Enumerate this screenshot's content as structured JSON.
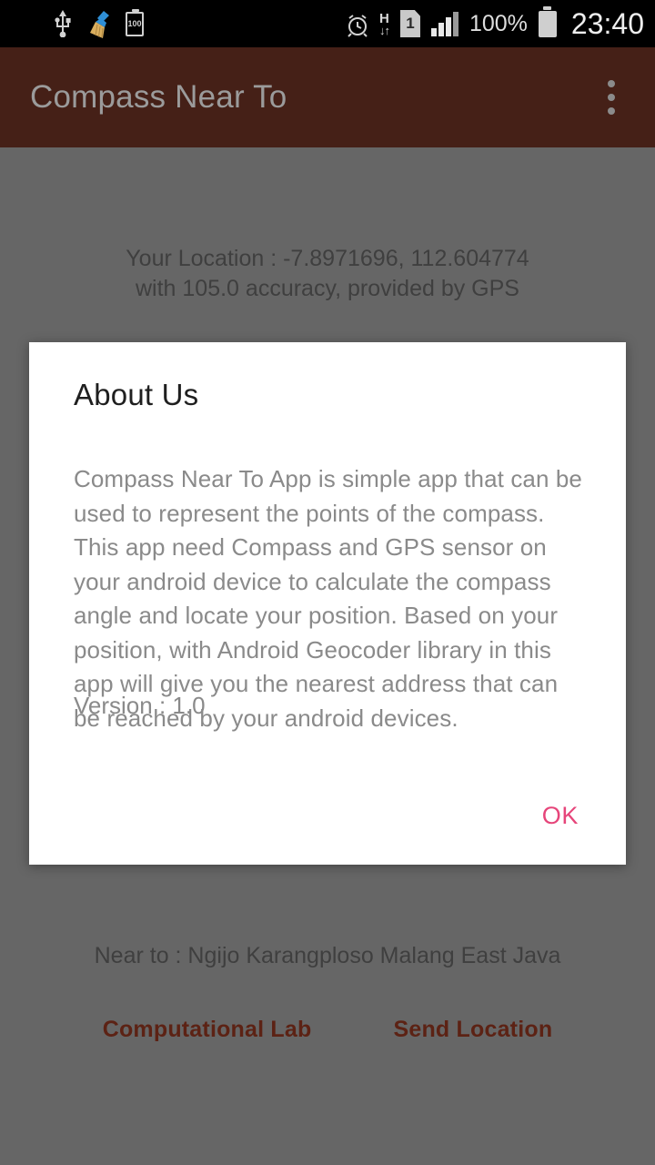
{
  "status_bar": {
    "time": "23:40",
    "battery_percent": "100%",
    "network_type": "H",
    "sim_label": "1",
    "battery_saver_label": "100",
    "icons": {
      "usb": "usb-icon",
      "cleaner": "broom-icon",
      "battery_widget": "battery-saver-icon",
      "alarm": "alarm-clock-icon",
      "data_transfer": "hspa-data-icon",
      "sim": "sim-card-icon",
      "signal": "signal-bars-icon",
      "battery": "battery-icon"
    },
    "colors": {
      "background": "#000000",
      "foreground": "#dedede"
    }
  },
  "app_bar": {
    "title": "Compass Near To",
    "overflow_label": "overflow-menu",
    "colors": {
      "background": "#452017",
      "title": "#9b9b9b"
    }
  },
  "main": {
    "location_line1": "Your Location : -7.8971696, 112.604774",
    "location_line2": "with 105.0 accuracy, provided by GPS",
    "near_to": "Near to : Ngijo Karangploso Malang East Java",
    "buttons": [
      {
        "label": "Computational Lab",
        "name": "computational-lab-button"
      },
      {
        "label": "Send Location",
        "name": "send-location-button"
      }
    ],
    "colors": {
      "scrim": "#666666",
      "text": "#3f3f3f",
      "button_text": "#5c2214"
    }
  },
  "dialog": {
    "title": "About Us",
    "body": "Compass Near To App is simple app that can be used to represent the points of the compass. This app need Compass and GPS sensor on your android device to calculate the compass angle and locate your position. Based on your position, with Android Geocoder library in this app will give you the nearest address that can be reached by your android devices.",
    "version": "Version : 1.0",
    "ok_label": "OK",
    "colors": {
      "surface": "#ffffff",
      "title": "#1f1f1f",
      "body": "#8a8a8a",
      "accent": "#e6457a"
    }
  }
}
